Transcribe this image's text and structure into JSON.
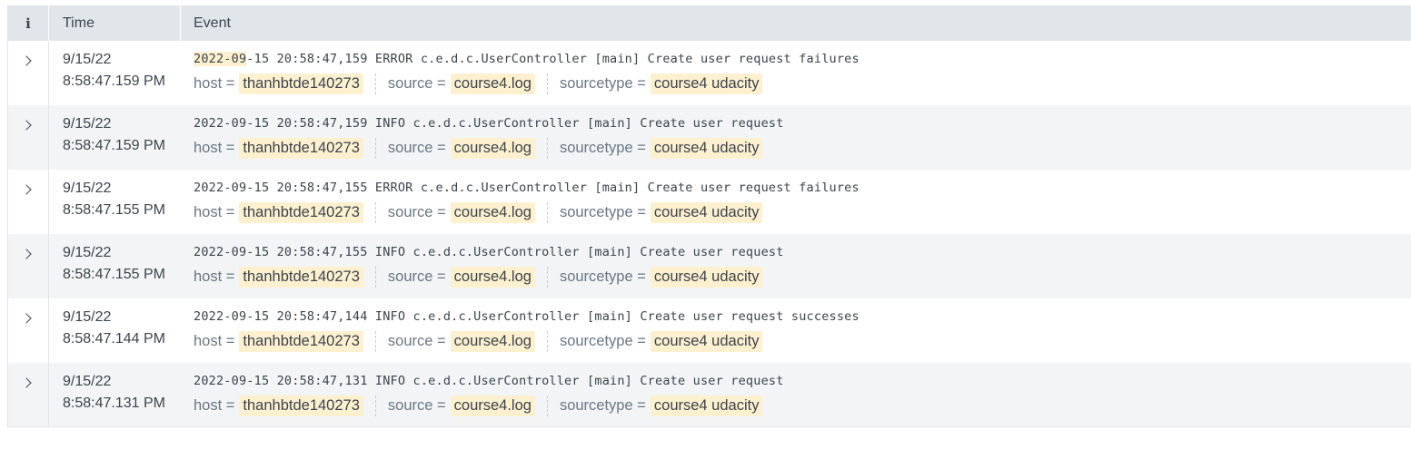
{
  "header": {
    "info_label": "i",
    "time_label": "Time",
    "event_label": "Event"
  },
  "field_labels": {
    "host": "host =",
    "source": "source =",
    "sourcetype": "sourcetype ="
  },
  "events": [
    {
      "date": "9/15/22",
      "time": "8:58:47.159 PM",
      "raw_highlight": "2022-09",
      "raw_rest": "-15 20:58:47,159 ERROR c.e.d.c.UserController [main] Create user request failures",
      "host": "thanhbtde140273",
      "source": "course4.log",
      "sourcetype": "course4 udacity"
    },
    {
      "date": "9/15/22",
      "time": "8:58:47.159 PM",
      "raw_highlight": "",
      "raw_rest": "2022-09-15 20:58:47,159 INFO c.e.d.c.UserController [main] Create user request",
      "host": "thanhbtde140273",
      "source": "course4.log",
      "sourcetype": "course4 udacity"
    },
    {
      "date": "9/15/22",
      "time": "8:58:47.155 PM",
      "raw_highlight": "",
      "raw_rest": "2022-09-15 20:58:47,155 ERROR c.e.d.c.UserController [main] Create user request failures",
      "host": "thanhbtde140273",
      "source": "course4.log",
      "sourcetype": "course4 udacity"
    },
    {
      "date": "9/15/22",
      "time": "8:58:47.155 PM",
      "raw_highlight": "",
      "raw_rest": "2022-09-15 20:58:47,155 INFO c.e.d.c.UserController [main] Create user request",
      "host": "thanhbtde140273",
      "source": "course4.log",
      "sourcetype": "course4 udacity"
    },
    {
      "date": "9/15/22",
      "time": "8:58:47.144 PM",
      "raw_highlight": "",
      "raw_rest": "2022-09-15 20:58:47,144 INFO c.e.d.c.UserController [main] Create user request successes",
      "host": "thanhbtde140273",
      "source": "course4.log",
      "sourcetype": "course4 udacity"
    },
    {
      "date": "9/15/22",
      "time": "8:58:47.131 PM",
      "raw_highlight": "",
      "raw_rest": "2022-09-15 20:58:47,131 INFO c.e.d.c.UserController [main] Create user request",
      "host": "thanhbtde140273",
      "source": "course4.log",
      "sourcetype": "course4 udacity"
    }
  ]
}
